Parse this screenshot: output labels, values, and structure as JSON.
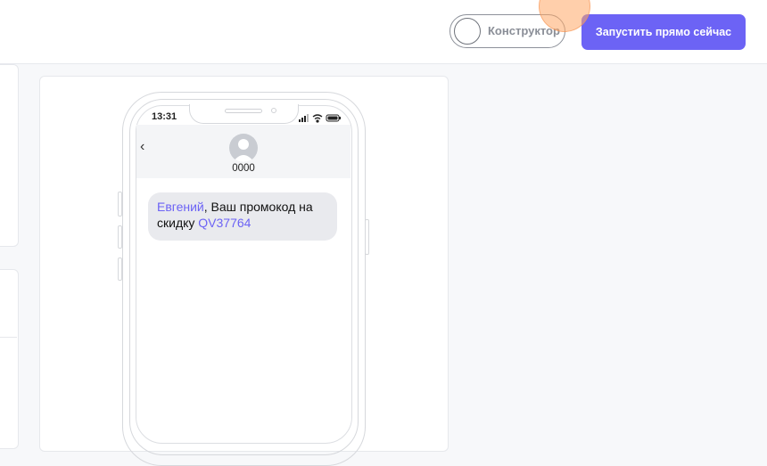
{
  "header": {
    "constructor_toggle_label": "Конструктор",
    "launch_button_label": "Запустить прямо сейчас"
  },
  "phone": {
    "status_time": "13:31",
    "contact_name": "0000",
    "message": {
      "name": "Евгений",
      "text_middle": ", Ваш промокод на скидку ",
      "promo_code": "QV37764"
    }
  },
  "colors": {
    "accent": "#6c63f5",
    "bubble": "#e9eaee",
    "page_background": "#f7f8fa"
  }
}
